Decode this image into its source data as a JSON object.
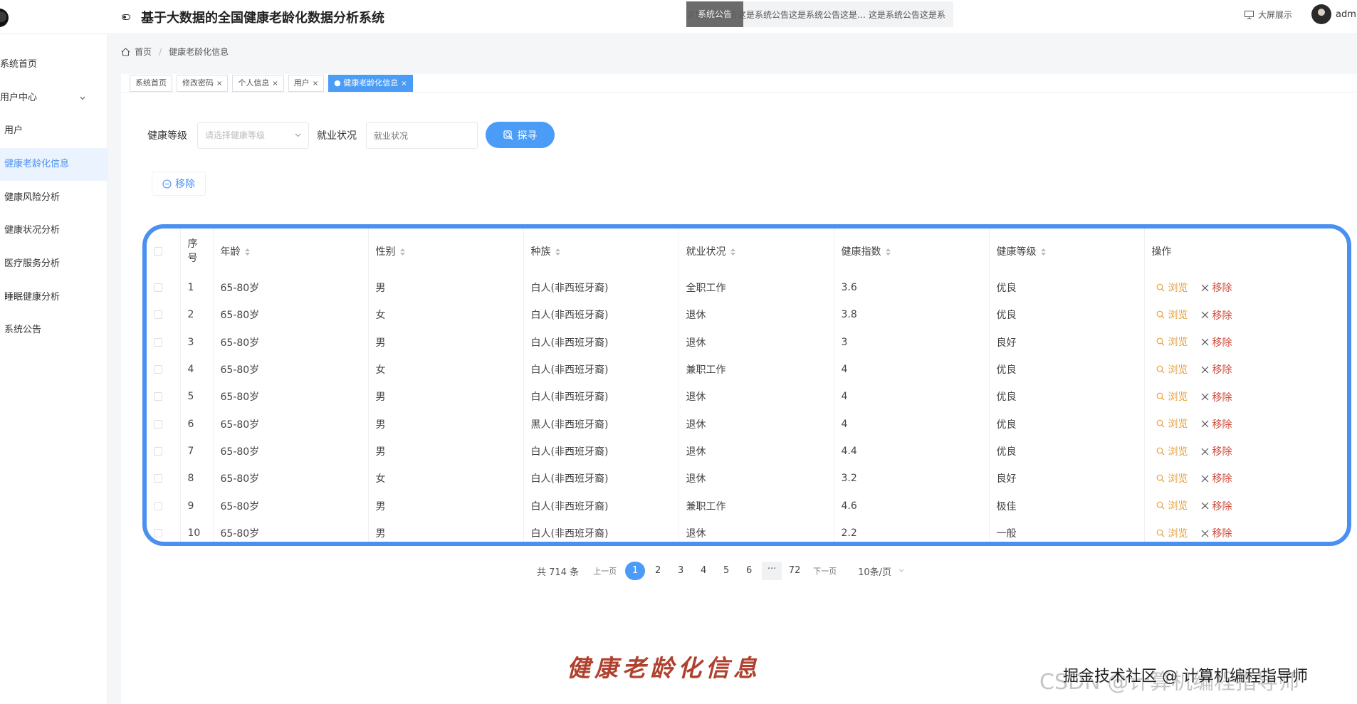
{
  "header": {
    "title": "基于大数据的全国健康老龄化数据分析系统",
    "notice_badge": "系统公告",
    "notice_text": "这是系统公告这是系统公告这是系统公告这是… 这是系统公告这是系",
    "big_screen": "大屏展示",
    "user_name": "admi"
  },
  "sidebar": {
    "items": [
      {
        "label": "系统首页"
      },
      {
        "label": "用户中心"
      },
      {
        "label": "用户"
      },
      {
        "label": "健康老龄化信息"
      },
      {
        "label": "健康风险分析"
      },
      {
        "label": "健康状况分析"
      },
      {
        "label": "医疗服务分析"
      },
      {
        "label": "睡眠健康分析"
      },
      {
        "label": "系统公告"
      }
    ]
  },
  "breadcrumb": {
    "home": "首页",
    "current": "健康老龄化信息"
  },
  "tags": [
    {
      "label": "系统首页"
    },
    {
      "label": "修改密码"
    },
    {
      "label": "个人信息"
    },
    {
      "label": "用户"
    },
    {
      "label": "健康老龄化信息"
    }
  ],
  "search": {
    "level_label": "健康等级",
    "level_placeholder": "请选择健康等级",
    "employment_label": "就业状况",
    "employment_placeholder": "就业状况",
    "search_button": "探寻"
  },
  "toolbar": {
    "remove_button": "移除"
  },
  "table": {
    "columns": [
      "序号",
      "年龄",
      "性别",
      "种族",
      "就业状况",
      "健康指数",
      "健康等级",
      "操作"
    ],
    "rows": [
      {
        "no": "1",
        "age": "65-80岁",
        "gender": "男",
        "race": "白人(非西班牙裔)",
        "employment": "全职工作",
        "index": "3.6",
        "level": "优良"
      },
      {
        "no": "2",
        "age": "65-80岁",
        "gender": "女",
        "race": "白人(非西班牙裔)",
        "employment": "退休",
        "index": "3.8",
        "level": "优良"
      },
      {
        "no": "3",
        "age": "65-80岁",
        "gender": "男",
        "race": "白人(非西班牙裔)",
        "employment": "退休",
        "index": "3",
        "level": "良好"
      },
      {
        "no": "4",
        "age": "65-80岁",
        "gender": "女",
        "race": "白人(非西班牙裔)",
        "employment": "兼职工作",
        "index": "4",
        "level": "优良"
      },
      {
        "no": "5",
        "age": "65-80岁",
        "gender": "男",
        "race": "白人(非西班牙裔)",
        "employment": "退休",
        "index": "4",
        "level": "优良"
      },
      {
        "no": "6",
        "age": "65-80岁",
        "gender": "男",
        "race": "黑人(非西班牙裔)",
        "employment": "退休",
        "index": "4",
        "level": "优良"
      },
      {
        "no": "7",
        "age": "65-80岁",
        "gender": "男",
        "race": "白人(非西班牙裔)",
        "employment": "退休",
        "index": "4.4",
        "level": "优良"
      },
      {
        "no": "8",
        "age": "65-80岁",
        "gender": "女",
        "race": "白人(非西班牙裔)",
        "employment": "退休",
        "index": "3.2",
        "level": "良好"
      },
      {
        "no": "9",
        "age": "65-80岁",
        "gender": "男",
        "race": "白人(非西班牙裔)",
        "employment": "兼职工作",
        "index": "4.6",
        "level": "极佳"
      },
      {
        "no": "10",
        "age": "65-80岁",
        "gender": "男",
        "race": "白人(非西班牙裔)",
        "employment": "退休",
        "index": "2.2",
        "level": "一般"
      }
    ],
    "view_label": "浏览",
    "delete_label": "移除"
  },
  "pagination": {
    "total": "共 714 条",
    "prev": "上一页",
    "pages": [
      "1",
      "2",
      "3",
      "4",
      "5",
      "6"
    ],
    "ellipsis": "···",
    "last": "72",
    "next": "下一页",
    "page_size": "10条/页"
  },
  "caption": "健康老龄化信息",
  "watermark": {
    "back": "CSDN @计算机编程指导师",
    "front": "掘金技术社区 @ 计算机编程指导师"
  },
  "colors": {
    "primary": "#4a9cf6",
    "view": "#e6a23c",
    "delete": "#d14a3a",
    "caption": "#b0412e"
  }
}
